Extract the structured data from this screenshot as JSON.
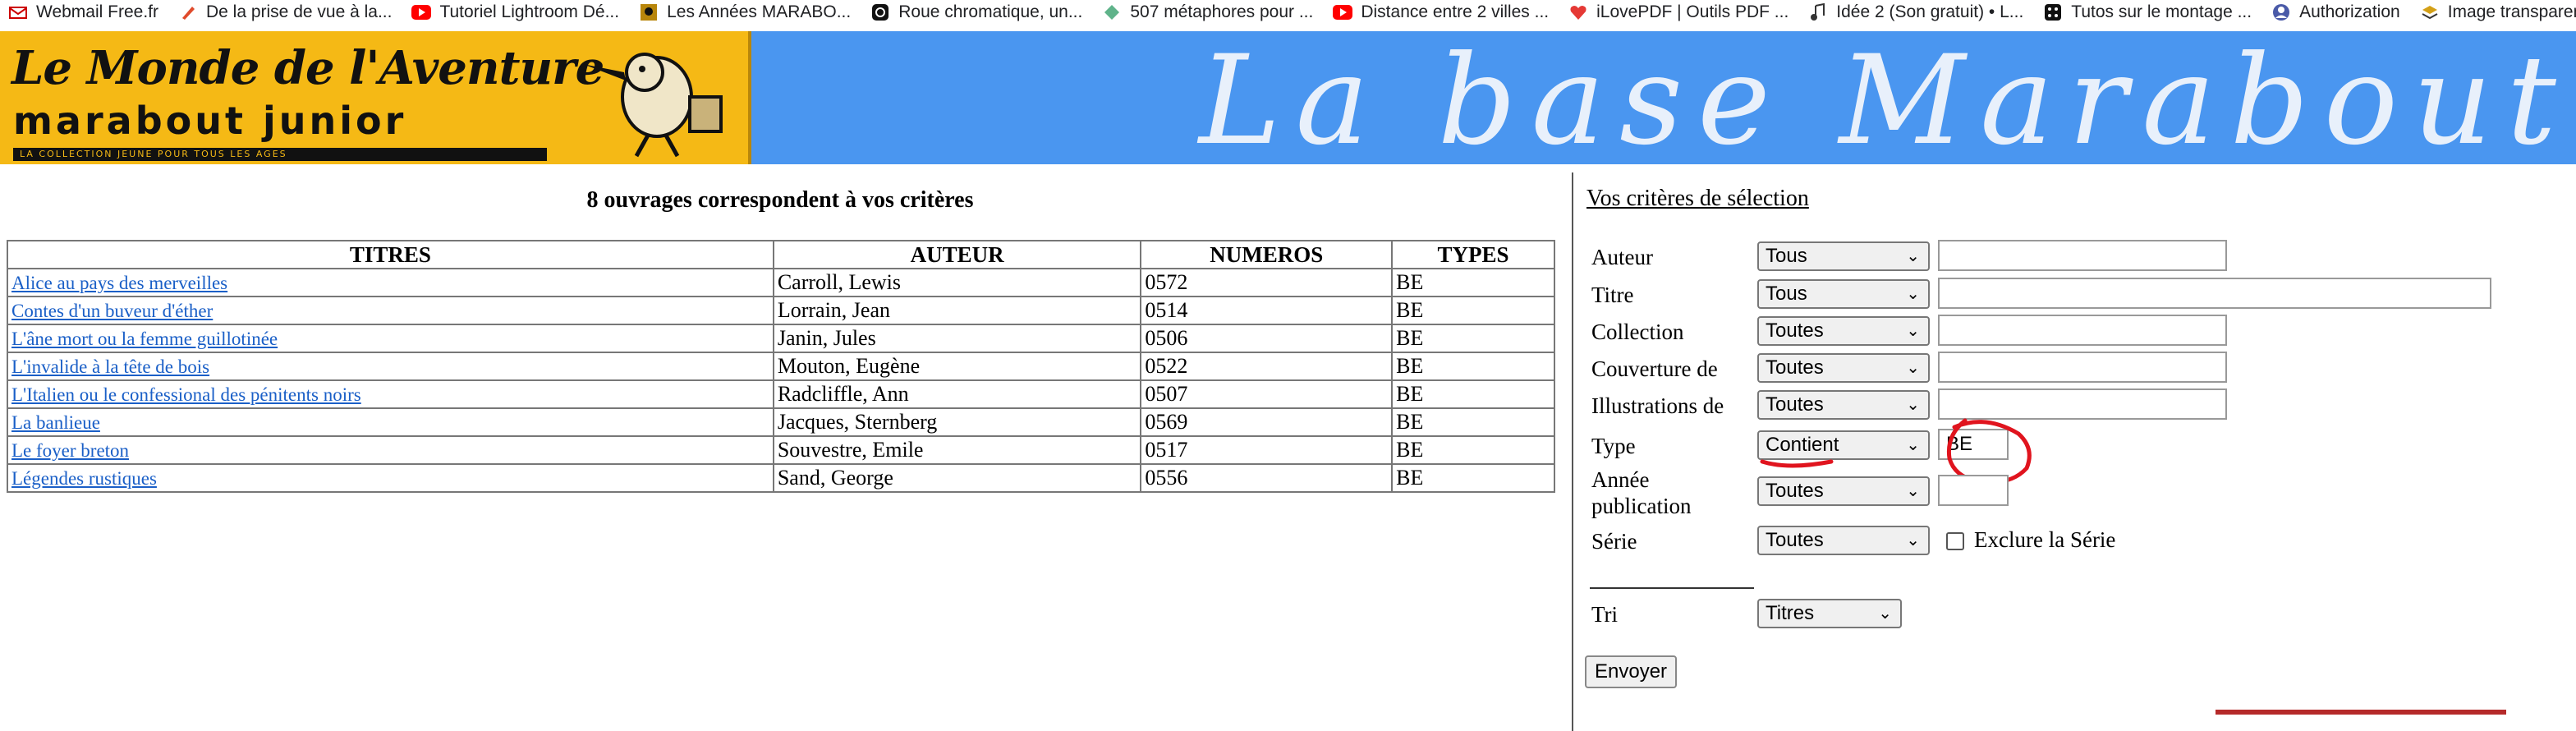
{
  "bookmarks": [
    {
      "label": "Webmail Free.fr",
      "icon": "free-icon",
      "color": "#cc0000"
    },
    {
      "label": "De la prise de vue à la...",
      "icon": "pencil-icon",
      "color": "#e04b2c"
    },
    {
      "label": "Tutoriel Lightroom Dé...",
      "icon": "youtube-icon",
      "color": "#ff0000"
    },
    {
      "label": "Les Années MARABO...",
      "icon": "marabout-icon",
      "color": "#b8860b"
    },
    {
      "label": "Roue chromatique, un...",
      "icon": "circle-icon",
      "color": "#111111"
    },
    {
      "label": "507 métaphores pour ...",
      "icon": "leaf-icon",
      "color": "#5fb38a"
    },
    {
      "label": "Distance entre 2 villes ...",
      "icon": "youtube-icon",
      "color": "#ff0000"
    },
    {
      "label": "iLovePDF | Outils PDF ...",
      "icon": "heart-icon",
      "color": "#e53935"
    },
    {
      "label": "Idée 2 (Son gratuit) • L...",
      "icon": "music-icon",
      "color": "#333333"
    },
    {
      "label": "Tutos sur le montage ...",
      "icon": "dice-icon",
      "color": "#111111"
    },
    {
      "label": "Authorization",
      "icon": "user-icon",
      "color": "#4a5aa8"
    },
    {
      "label": "Image transparente",
      "icon": "stack-icon",
      "color": "#d4a017"
    }
  ],
  "banner": {
    "logo_line1": "Le Monde de l'Aventure",
    "logo_line2": "marabout junior",
    "logo_tagline": "LA COLLECTION JEUNE POUR TOUS LES AGES",
    "title": "La base Marabout"
  },
  "results": {
    "summary": "8 ouvrages correspondent à vos critères",
    "headers": [
      "TITRES",
      "AUTEUR",
      "NUMEROS",
      "TYPES"
    ],
    "rows": [
      {
        "title": "Alice au pays des merveilles",
        "author": "Carroll, Lewis",
        "number": "0572",
        "type": "BE"
      },
      {
        "title": "Contes d'un buveur d'éther",
        "author": "Lorrain, Jean",
        "number": "0514",
        "type": "BE"
      },
      {
        "title": "L'âne mort ou la femme guillotinée",
        "author": "Janin, Jules",
        "number": "0506",
        "type": "BE"
      },
      {
        "title": "L'invalide à la tête de bois",
        "author": "Mouton, Eugène",
        "number": "0522",
        "type": "BE"
      },
      {
        "title": "L'Italien ou le confessional des pénitents noirs",
        "author": "Radcliffle, Ann",
        "number": "0507",
        "type": "BE"
      },
      {
        "title": "La banlieue",
        "author": "Jacques, Sternberg",
        "number": "0569",
        "type": "BE"
      },
      {
        "title": "Le foyer breton",
        "author": "Souvestre, Emile",
        "number": "0517",
        "type": "BE"
      },
      {
        "title": "Légendes rustiques",
        "author": "Sand, George",
        "number": "0556",
        "type": "BE"
      }
    ]
  },
  "criteria": {
    "title": "Vos critères de sélection",
    "fields": {
      "auteur": {
        "label": "Auteur",
        "select": "Tous",
        "value": ""
      },
      "titre": {
        "label": "Titre",
        "select": "Tous",
        "value": ""
      },
      "collection": {
        "label": "Collection",
        "select": "Toutes",
        "value": ""
      },
      "couverture": {
        "label": "Couverture de",
        "select": "Toutes",
        "value": ""
      },
      "illustrations": {
        "label": "Illustrations de",
        "select": "Toutes",
        "value": ""
      },
      "type": {
        "label": "Type",
        "select": "Contient",
        "value": "BE"
      },
      "annee": {
        "label": "Année publication",
        "select": "Toutes",
        "value": ""
      },
      "serie": {
        "label": "Série",
        "select": "Toutes",
        "exclude_label": "Exclure la Série"
      },
      "tri": {
        "label": "Tri",
        "select": "Titres"
      }
    },
    "submit": "Envoyer",
    "annotation_color": "#e0141e"
  }
}
